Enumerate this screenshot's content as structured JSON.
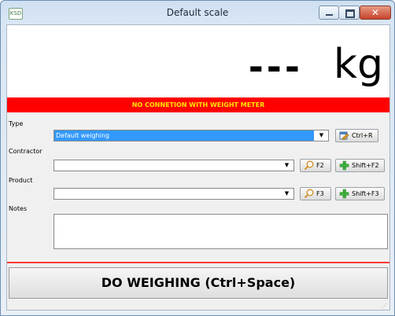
{
  "window": {
    "title": "Default scale",
    "app_icon_text": "KSD",
    "close_glyph": "✕"
  },
  "display": {
    "weight_value": "---",
    "unit": "kg"
  },
  "status_message": "NO CONNETION WITH WEIGHT METER",
  "form": {
    "type": {
      "label": "Type",
      "value": "Default weighing",
      "button_label": "Ctrl+R"
    },
    "contractor": {
      "label": "Contractor",
      "value": "",
      "search_label": "F2",
      "add_label": "Shift+F2"
    },
    "product": {
      "label": "Product",
      "value": "",
      "search_label": "F3",
      "add_label": "Shift+F3"
    },
    "notes": {
      "label": "Notes",
      "value": ""
    }
  },
  "do_weighing_label": "DO WEIGHING (Ctrl+Space)",
  "colors": {
    "status_bg": "#ff0000",
    "status_text": "#ffe400",
    "selection": "#3399ff",
    "add_icon": "#3cb33c"
  }
}
